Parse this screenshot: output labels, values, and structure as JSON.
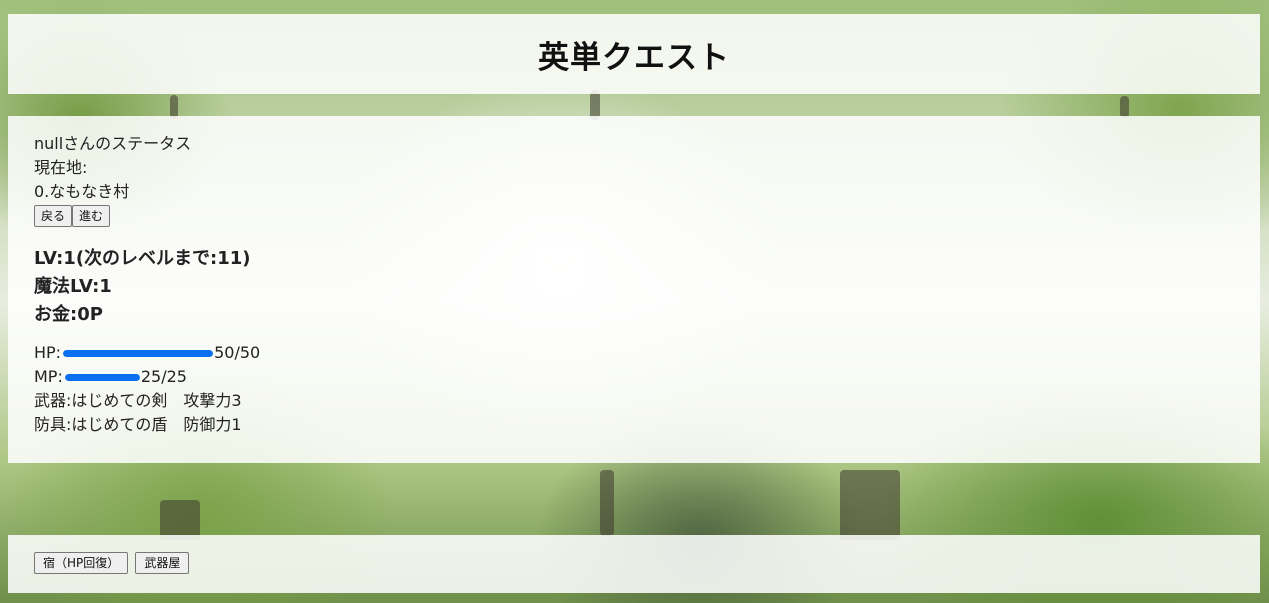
{
  "header": {
    "title": "英単クエスト"
  },
  "status": {
    "heading": "nullさんのステータス",
    "location_label": "現在地:",
    "location_value": "0.なもなき村",
    "back_button": "戻る",
    "forward_button": "進む",
    "level": "LV:1(次のレベルまで:11)",
    "magic_level": "魔法LV:1",
    "money": "お金:0P",
    "hp_label": "HP:",
    "hp_value": "50/50",
    "hp_fraction": 1.0,
    "mp_label": "MP:",
    "mp_value": "25/25",
    "mp_fraction": 1.0,
    "weapon": "武器:はじめての剣　攻撃力3",
    "armor": "防具:はじめての盾　防御力1"
  },
  "footer": {
    "inn_button": "宿（HP回復）",
    "weapon_shop_button": "武器屋"
  },
  "colors": {
    "bar_fill": "#0a6ff0",
    "panel_background": "rgba(255,255,255,0.86)"
  }
}
